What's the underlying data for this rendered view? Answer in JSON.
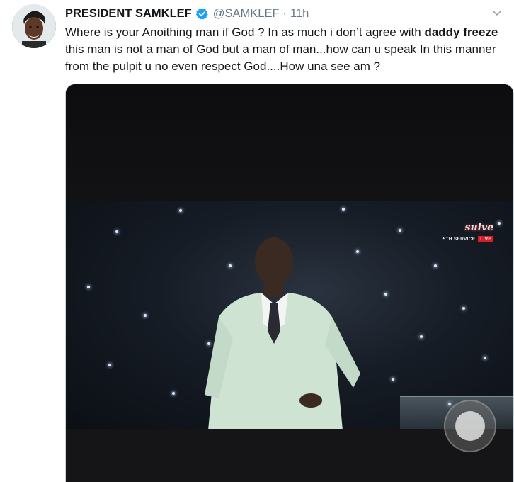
{
  "tweet": {
    "display_name": "PRESIDENT SAMKLEF",
    "handle": "@SAMKLEF",
    "separator": "·",
    "time": "11h",
    "text_part1": "Where is your Anoithing  man if God ? In as much i don’t agree with ",
    "text_bold": "daddy freeze",
    "text_part2": " this man is not a man of God but a man of man...how can u speak In this manner from the pulpit u no even respect God....How una see am ?"
  },
  "video": {
    "overlay_logo": "sulve",
    "service_label": "5TH SERVICE",
    "live_label": "LIVE"
  },
  "icons": {
    "verified": "verified-badge-icon",
    "more": "chevron-down-icon",
    "play": "play-control-icon"
  },
  "colors": {
    "name": "#14171a",
    "secondary": "#657786",
    "verified": "#1da1f2",
    "live": "#d61f26"
  }
}
